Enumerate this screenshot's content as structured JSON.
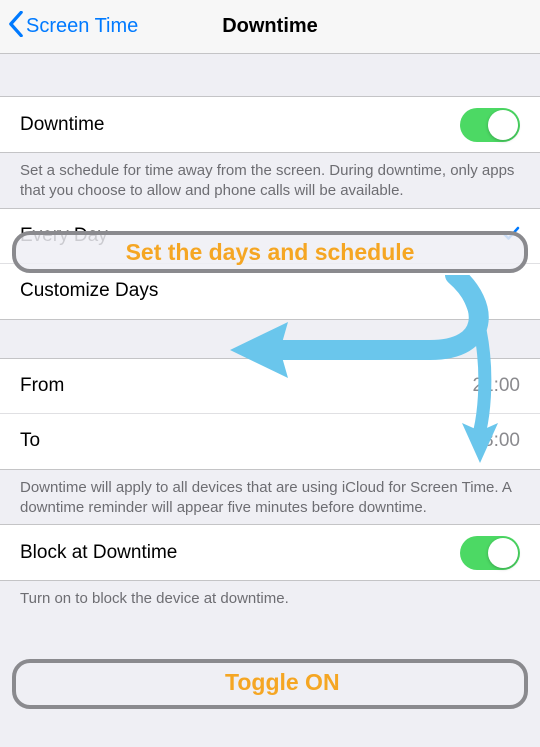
{
  "nav": {
    "back_label": "Screen Time",
    "title": "Downtime"
  },
  "section1": {
    "downtime_label": "Downtime",
    "downtime_on": true,
    "description": "Set a schedule for time away from the screen. During downtime, only apps that you choose to allow and phone calls will be available."
  },
  "section2": {
    "every_day_label": "Every Day",
    "every_day_selected": true,
    "customize_label": "Customize Days"
  },
  "section3": {
    "from_label": "From",
    "from_value": "21:00",
    "to_label": "To",
    "to_value": "08:00"
  },
  "footer_icloud": "Downtime will apply to all devices that are using iCloud for Screen Time. A downtime reminder will appear five minutes before downtime.",
  "section4": {
    "block_label": "Block at Downtime",
    "block_on": true,
    "footer": "Turn on to block the device at downtime."
  },
  "annotations": {
    "schedule_text": "Set the days and schedule",
    "toggle_text": "Toggle ON"
  },
  "colors": {
    "accent_blue": "#007aff",
    "toggle_green": "#4cd964",
    "annotation_orange": "#f5a623",
    "arrow_blue": "#6ac6ec",
    "annotation_border": "#8a8a8e"
  }
}
